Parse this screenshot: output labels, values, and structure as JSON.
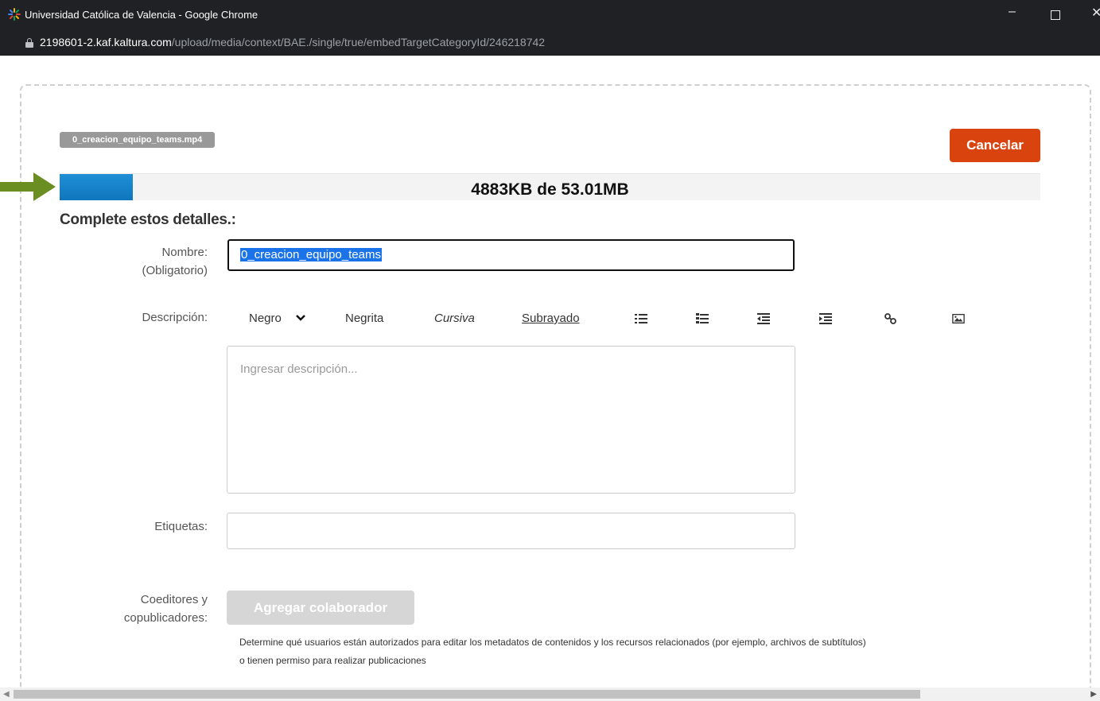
{
  "browser": {
    "window_title": "Universidad Católica de Valencia - Google Chrome",
    "url_host": "2198601-2.kaf.kaltura.com",
    "url_path": "/upload/media/context/BAE./single/true/embedTargetCategoryId/246218742",
    "controls": {
      "minimize": "–",
      "close": "✕"
    }
  },
  "upload": {
    "filename": "0_creacion_equipo_teams.mp4",
    "cancel_label": "Cancelar",
    "progress_text": "4883KB de 53.01MB",
    "progress_fraction": 0.075,
    "accent_color": "#0f76bd",
    "cancel_color": "#d9440e"
  },
  "form": {
    "section_title": "Complete estos detalles.:",
    "name_label_1": "Nombre:",
    "name_label_2": "(Obligatorio)",
    "name_value": "0_creacion_equipo_teams",
    "description_label": "Descripción:",
    "description_placeholder": "Ingresar descripción...",
    "toolbar": {
      "color_label": "Negro",
      "bold_label": "Negrita",
      "italic_label": "Cursiva",
      "underline_label": "Subrayado",
      "icons": [
        "bullet-list-icon",
        "numbered-list-icon",
        "outdent-icon",
        "indent-icon",
        "link-icon",
        "image-icon"
      ]
    },
    "tags_label": "Etiquetas:",
    "coeditors_label_1": "Coeditores y",
    "coeditors_label_2": "copublicadores:",
    "add_collab_label": "Agregar colaborador",
    "help_line_1": "Determine qué usuarios están autorizados para editar los metadatos de contenidos y los recursos relacionados (por ejemplo, archivos de subtítulos)",
    "help_line_2": "o tienen permiso para realizar publicaciones"
  }
}
